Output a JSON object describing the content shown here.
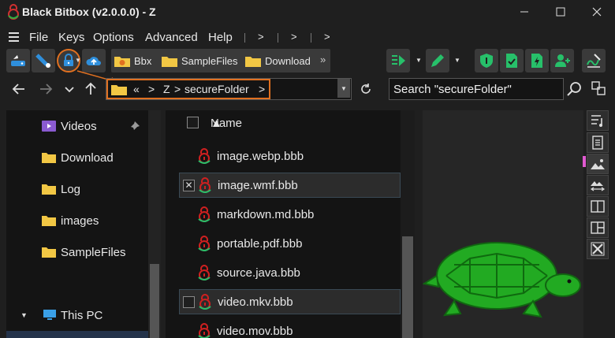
{
  "window": {
    "title": "Black Bitbox (v2.0.0.0) - Z",
    "controls": [
      "minimize",
      "maximize",
      "close"
    ]
  },
  "menu": {
    "items": [
      "File",
      "Keys",
      "Options",
      "Advanced",
      "Help"
    ],
    "overflow_arrows": [
      ">",
      ">",
      ">"
    ]
  },
  "toolbar": {
    "bookmarks": [
      "Bbx",
      "SampleFiles",
      "Download"
    ],
    "bookmarks_more": "»"
  },
  "address": {
    "breadcrumb": [
      "«",
      "Z",
      "secureFolder"
    ],
    "separator": ">"
  },
  "search": {
    "placeholder": "Search \"secureFolder\""
  },
  "sidebar": {
    "items": [
      {
        "label": "Videos",
        "icon": "videos-folder-icon",
        "pinned": true
      },
      {
        "label": "Download",
        "icon": "folder-icon"
      },
      {
        "label": "Log",
        "icon": "folder-icon"
      },
      {
        "label": "images",
        "icon": "folder-icon"
      },
      {
        "label": "SampleFiles",
        "icon": "folder-icon"
      },
      {
        "label": "This PC",
        "icon": "computer-icon",
        "expanded": true
      }
    ]
  },
  "filelist": {
    "column_name": "Name",
    "sort": "▲",
    "rows": [
      {
        "name": "image.webp.bbb",
        "checked": false,
        "selected": false
      },
      {
        "name": "image.wmf.bbb",
        "checked": true,
        "selected": true
      },
      {
        "name": "markdown.md.bbb",
        "checked": false,
        "selected": false
      },
      {
        "name": "portable.pdf.bbb",
        "checked": false,
        "selected": false
      },
      {
        "name": "source.java.bbb",
        "checked": false,
        "selected": false
      },
      {
        "name": "video.mkv.bbb",
        "checked": false,
        "selected": true
      },
      {
        "name": "video.mov.bbb",
        "checked": false,
        "selected": false
      }
    ],
    "check_mark": "✕"
  },
  "colors": {
    "background": "#1f1f1f",
    "panel": "#141414",
    "accent_blue": "#2f8fdc",
    "accent_green": "#27c06a",
    "highlight_orange": "#e07020",
    "lock_red": "#d02020",
    "turtle_green": "#22aa22"
  }
}
